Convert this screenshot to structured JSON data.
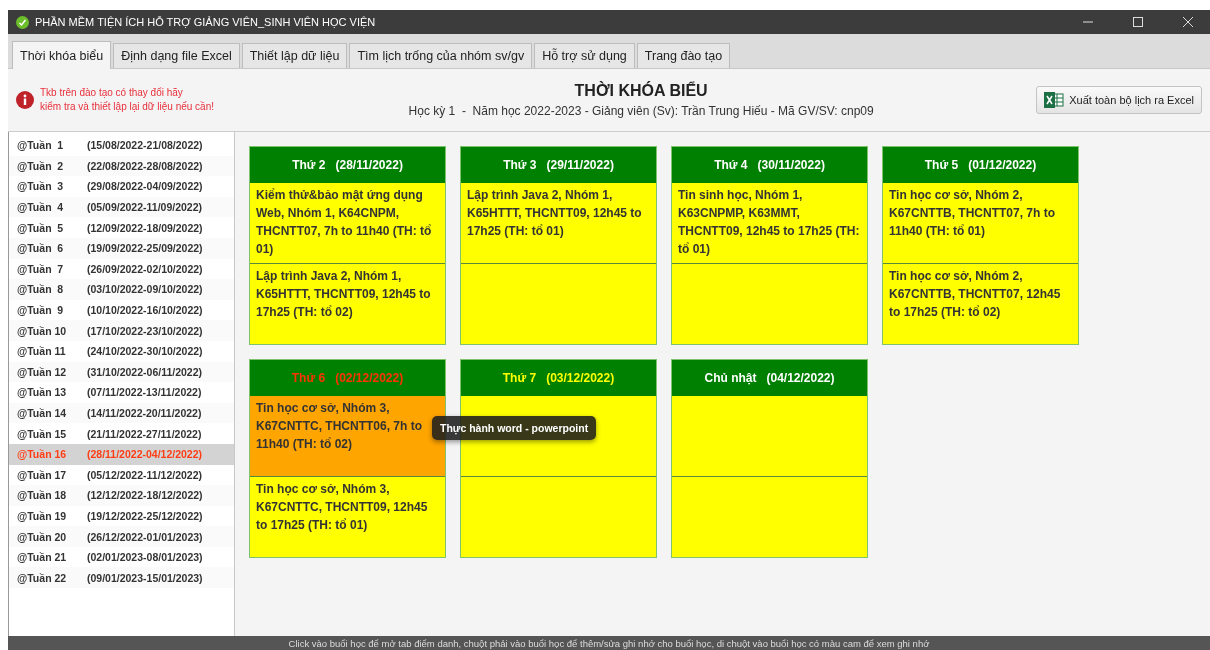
{
  "window": {
    "title": "PHẦN MỀM TIỆN ÍCH HỖ TRỢ GIẢNG VIÊN_SINH VIÊN HỌC VIỆN"
  },
  "tabs": [
    {
      "label": "Thời khóa biểu",
      "selected": true
    },
    {
      "label": "Định dạng file Excel",
      "selected": false
    },
    {
      "label": "Thiết lập dữ liệu",
      "selected": false
    },
    {
      "label": "Tìm lịch trống của nhóm sv/gv",
      "selected": false
    },
    {
      "label": "Hỗ trợ sử dụng",
      "selected": false
    },
    {
      "label": "Trang đào tạo",
      "selected": false
    }
  ],
  "warning": "Tkb trên đào tạo có thay đổi hãy\nkiểm tra và thiết lập lại dữ liệu nếu cần!",
  "header": {
    "title": "THỜI KHÓA BIỂU",
    "subtitle": "Học kỳ 1  -  Năm học 2022-2023 - Giảng viên (Sv): Trần Trung Hiếu - Mã GV/SV: cnp09"
  },
  "export_button": "Xuất toàn bộ lịch ra Excel",
  "weeks": [
    {
      "label": "@Tuần  1",
      "range": "(15/08/2022-21/08/2022)",
      "selected": false
    },
    {
      "label": "@Tuần  2",
      "range": "(22/08/2022-28/08/2022)",
      "selected": false
    },
    {
      "label": "@Tuần  3",
      "range": "(29/08/2022-04/09/2022)",
      "selected": false
    },
    {
      "label": "@Tuần  4",
      "range": "(05/09/2022-11/09/2022)",
      "selected": false
    },
    {
      "label": "@Tuần  5",
      "range": "(12/09/2022-18/09/2022)",
      "selected": false
    },
    {
      "label": "@Tuần  6",
      "range": "(19/09/2022-25/09/2022)",
      "selected": false
    },
    {
      "label": "@Tuần  7",
      "range": "(26/09/2022-02/10/2022)",
      "selected": false
    },
    {
      "label": "@Tuần  8",
      "range": "(03/10/2022-09/10/2022)",
      "selected": false
    },
    {
      "label": "@Tuần  9",
      "range": "(10/10/2022-16/10/2022)",
      "selected": false
    },
    {
      "label": "@Tuần 10",
      "range": "(17/10/2022-23/10/2022)",
      "selected": false
    },
    {
      "label": "@Tuần 11",
      "range": "(24/10/2022-30/10/2022)",
      "selected": false
    },
    {
      "label": "@Tuần 12",
      "range": "(31/10/2022-06/11/2022)",
      "selected": false
    },
    {
      "label": "@Tuần 13",
      "range": "(07/11/2022-13/11/2022)",
      "selected": false
    },
    {
      "label": "@Tuần 14",
      "range": "(14/11/2022-20/11/2022)",
      "selected": false
    },
    {
      "label": "@Tuần 15",
      "range": "(21/11/2022-27/11/2022)",
      "selected": false
    },
    {
      "label": "@Tuần 16",
      "range": "(28/11/2022-04/12/2022)",
      "selected": true
    },
    {
      "label": "@Tuần 17",
      "range": "(05/12/2022-11/12/2022)",
      "selected": false
    },
    {
      "label": "@Tuần 18",
      "range": "(12/12/2022-18/12/2022)",
      "selected": false
    },
    {
      "label": "@Tuần 19",
      "range": "(19/12/2022-25/12/2022)",
      "selected": false
    },
    {
      "label": "@Tuần 20",
      "range": "(26/12/2022-01/01/2023)",
      "selected": false
    },
    {
      "label": "@Tuần 21",
      "range": "(02/01/2023-08/01/2023)",
      "selected": false
    },
    {
      "label": "@Tuần 22",
      "range": "(09/01/2023-15/01/2023)",
      "selected": false
    }
  ],
  "days": [
    {
      "title": "Thứ 2   (28/11/2022)",
      "color": "#ffffff",
      "slots": [
        {
          "kind": "class",
          "text": "Kiểm thử&bảo mật ứng dụng Web, Nhóm 1, K64CNPM, THCNTT07, 7h to 11h40 (TH: tổ 01)",
          "has_note": false
        },
        {
          "kind": "class",
          "text": "Lập trình Java 2, Nhóm 1, K65HTTT, THCNTT09, 12h45 to 17h25 (TH: tổ 02)",
          "has_note": false
        }
      ]
    },
    {
      "title": "Thứ 3   (29/11/2022)",
      "color": "#ffffff",
      "slots": [
        {
          "kind": "class",
          "text": "Lập trình Java 2, Nhóm 1, K65HTTT, THCNTT09, 12h45 to 17h25 (TH: tổ 01)",
          "has_note": false
        },
        {
          "kind": "empty"
        }
      ]
    },
    {
      "title": "Thứ 4   (30/11/2022)",
      "color": "#ffffff",
      "slots": [
        {
          "kind": "class",
          "text": "Tin sinh học, Nhóm 1, K63CNPMP, K63MMT, THCNTT09, 12h45 to 17h25 (TH: tổ 01)",
          "has_note": false
        },
        {
          "kind": "empty"
        }
      ]
    },
    {
      "title": "Thứ 5   (01/12/2022)",
      "color": "#ffffff",
      "slots": [
        {
          "kind": "class",
          "text": "Tin học cơ sở, Nhóm 2, K67CNTTB, THCNTT07, 7h to 11h40 (TH: tổ 01)",
          "has_note": false
        },
        {
          "kind": "class",
          "text": "Tin học cơ sở, Nhóm 2, K67CNTTB, THCNTT07, 12h45 to 17h25 (TH: tổ 02)",
          "has_note": false
        }
      ]
    },
    {
      "title": "Thứ 6   (02/12/2022)",
      "color": "#ff3300",
      "slots": [
        {
          "kind": "class",
          "text": "Tin học cơ sở, Nhóm 3, K67CNTTC, THCNTT06, 7h to 11h40 (TH: tổ 02)",
          "has_note": true,
          "tooltip": "Thực hành word - powerpoint"
        },
        {
          "kind": "class",
          "text": "Tin học cơ sở, Nhóm 3, K67CNTTC, THCNTT09, 12h45 to 17h25 (TH: tổ 01)",
          "has_note": false
        }
      ]
    },
    {
      "title": "Thứ 7   (03/12/2022)",
      "color": "#ffff00",
      "slots": [
        {
          "kind": "empty"
        },
        {
          "kind": "empty"
        }
      ]
    },
    {
      "title": "Chủ nhật   (04/12/2022)",
      "color": "#ffffff",
      "slots": [
        {
          "kind": "empty"
        },
        {
          "kind": "empty"
        }
      ]
    }
  ],
  "status_bar": "Click vào buổi học để mở tab điểm danh, chuột phải vào buổi học để thêm/sửa ghi nhớ cho buổi học, di chuột vào buổi học có màu cam để xem ghi nhớ"
}
